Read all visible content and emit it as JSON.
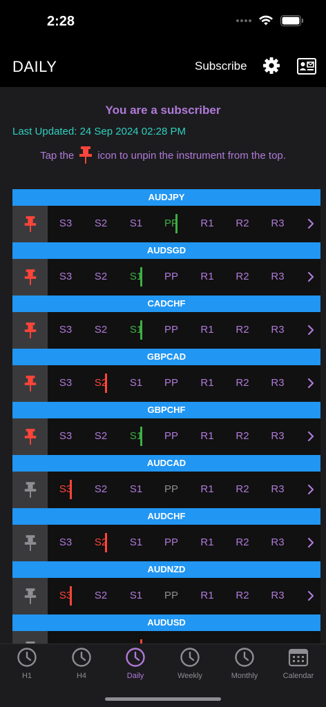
{
  "status": {
    "time": "2:28"
  },
  "nav": {
    "title": "DAILY",
    "subscribe": "Subscribe"
  },
  "banner": {
    "title": "You are a subscriber",
    "last_updated": "Last Updated: 24 Sep 2024 02:28 PM",
    "hint_before": "Tap the",
    "hint_after": "icon to unpin the instrument from the top."
  },
  "levels": [
    "S3",
    "S2",
    "S1",
    "PP",
    "R1",
    "R2",
    "R3"
  ],
  "instruments": [
    {
      "symbol": "AUDJPY",
      "pinned": true,
      "marker_after": 4,
      "marker_color": "green"
    },
    {
      "symbol": "AUDSGD",
      "pinned": true,
      "marker_after": 3,
      "marker_color": "green"
    },
    {
      "symbol": "CADCHF",
      "pinned": true,
      "marker_after": 3,
      "marker_color": "green"
    },
    {
      "symbol": "GBPCAD",
      "pinned": true,
      "marker_after": 2,
      "marker_color": "red"
    },
    {
      "symbol": "GBPCHF",
      "pinned": true,
      "marker_after": 3,
      "marker_color": "green"
    },
    {
      "symbol": "AUDCAD",
      "pinned": false,
      "marker_after": 1,
      "marker_color": "red"
    },
    {
      "symbol": "AUDCHF",
      "pinned": false,
      "marker_after": 2,
      "marker_color": "red"
    },
    {
      "symbol": "AUDNZD",
      "pinned": false,
      "marker_after": 1,
      "marker_color": "red"
    },
    {
      "symbol": "AUDUSD",
      "pinned": false,
      "marker_after": 3,
      "marker_color": "red"
    }
  ],
  "colors": {
    "accent": "#b07ad9",
    "header_blue": "#2196f3",
    "green": "#3cb043",
    "red": "#ff453a",
    "pin_pinned": "#ff453a",
    "pin_unpinned": "#8e8e93"
  },
  "tabs": [
    {
      "label": "H1",
      "icon": "clock-icon",
      "active": false
    },
    {
      "label": "H4",
      "icon": "clock-icon",
      "active": false
    },
    {
      "label": "Daily",
      "icon": "clock-icon",
      "active": true
    },
    {
      "label": "Weekly",
      "icon": "clock-icon",
      "active": false
    },
    {
      "label": "Monthly",
      "icon": "clock-icon",
      "active": false
    },
    {
      "label": "Calendar",
      "icon": "calendar-icon",
      "active": false
    }
  ]
}
